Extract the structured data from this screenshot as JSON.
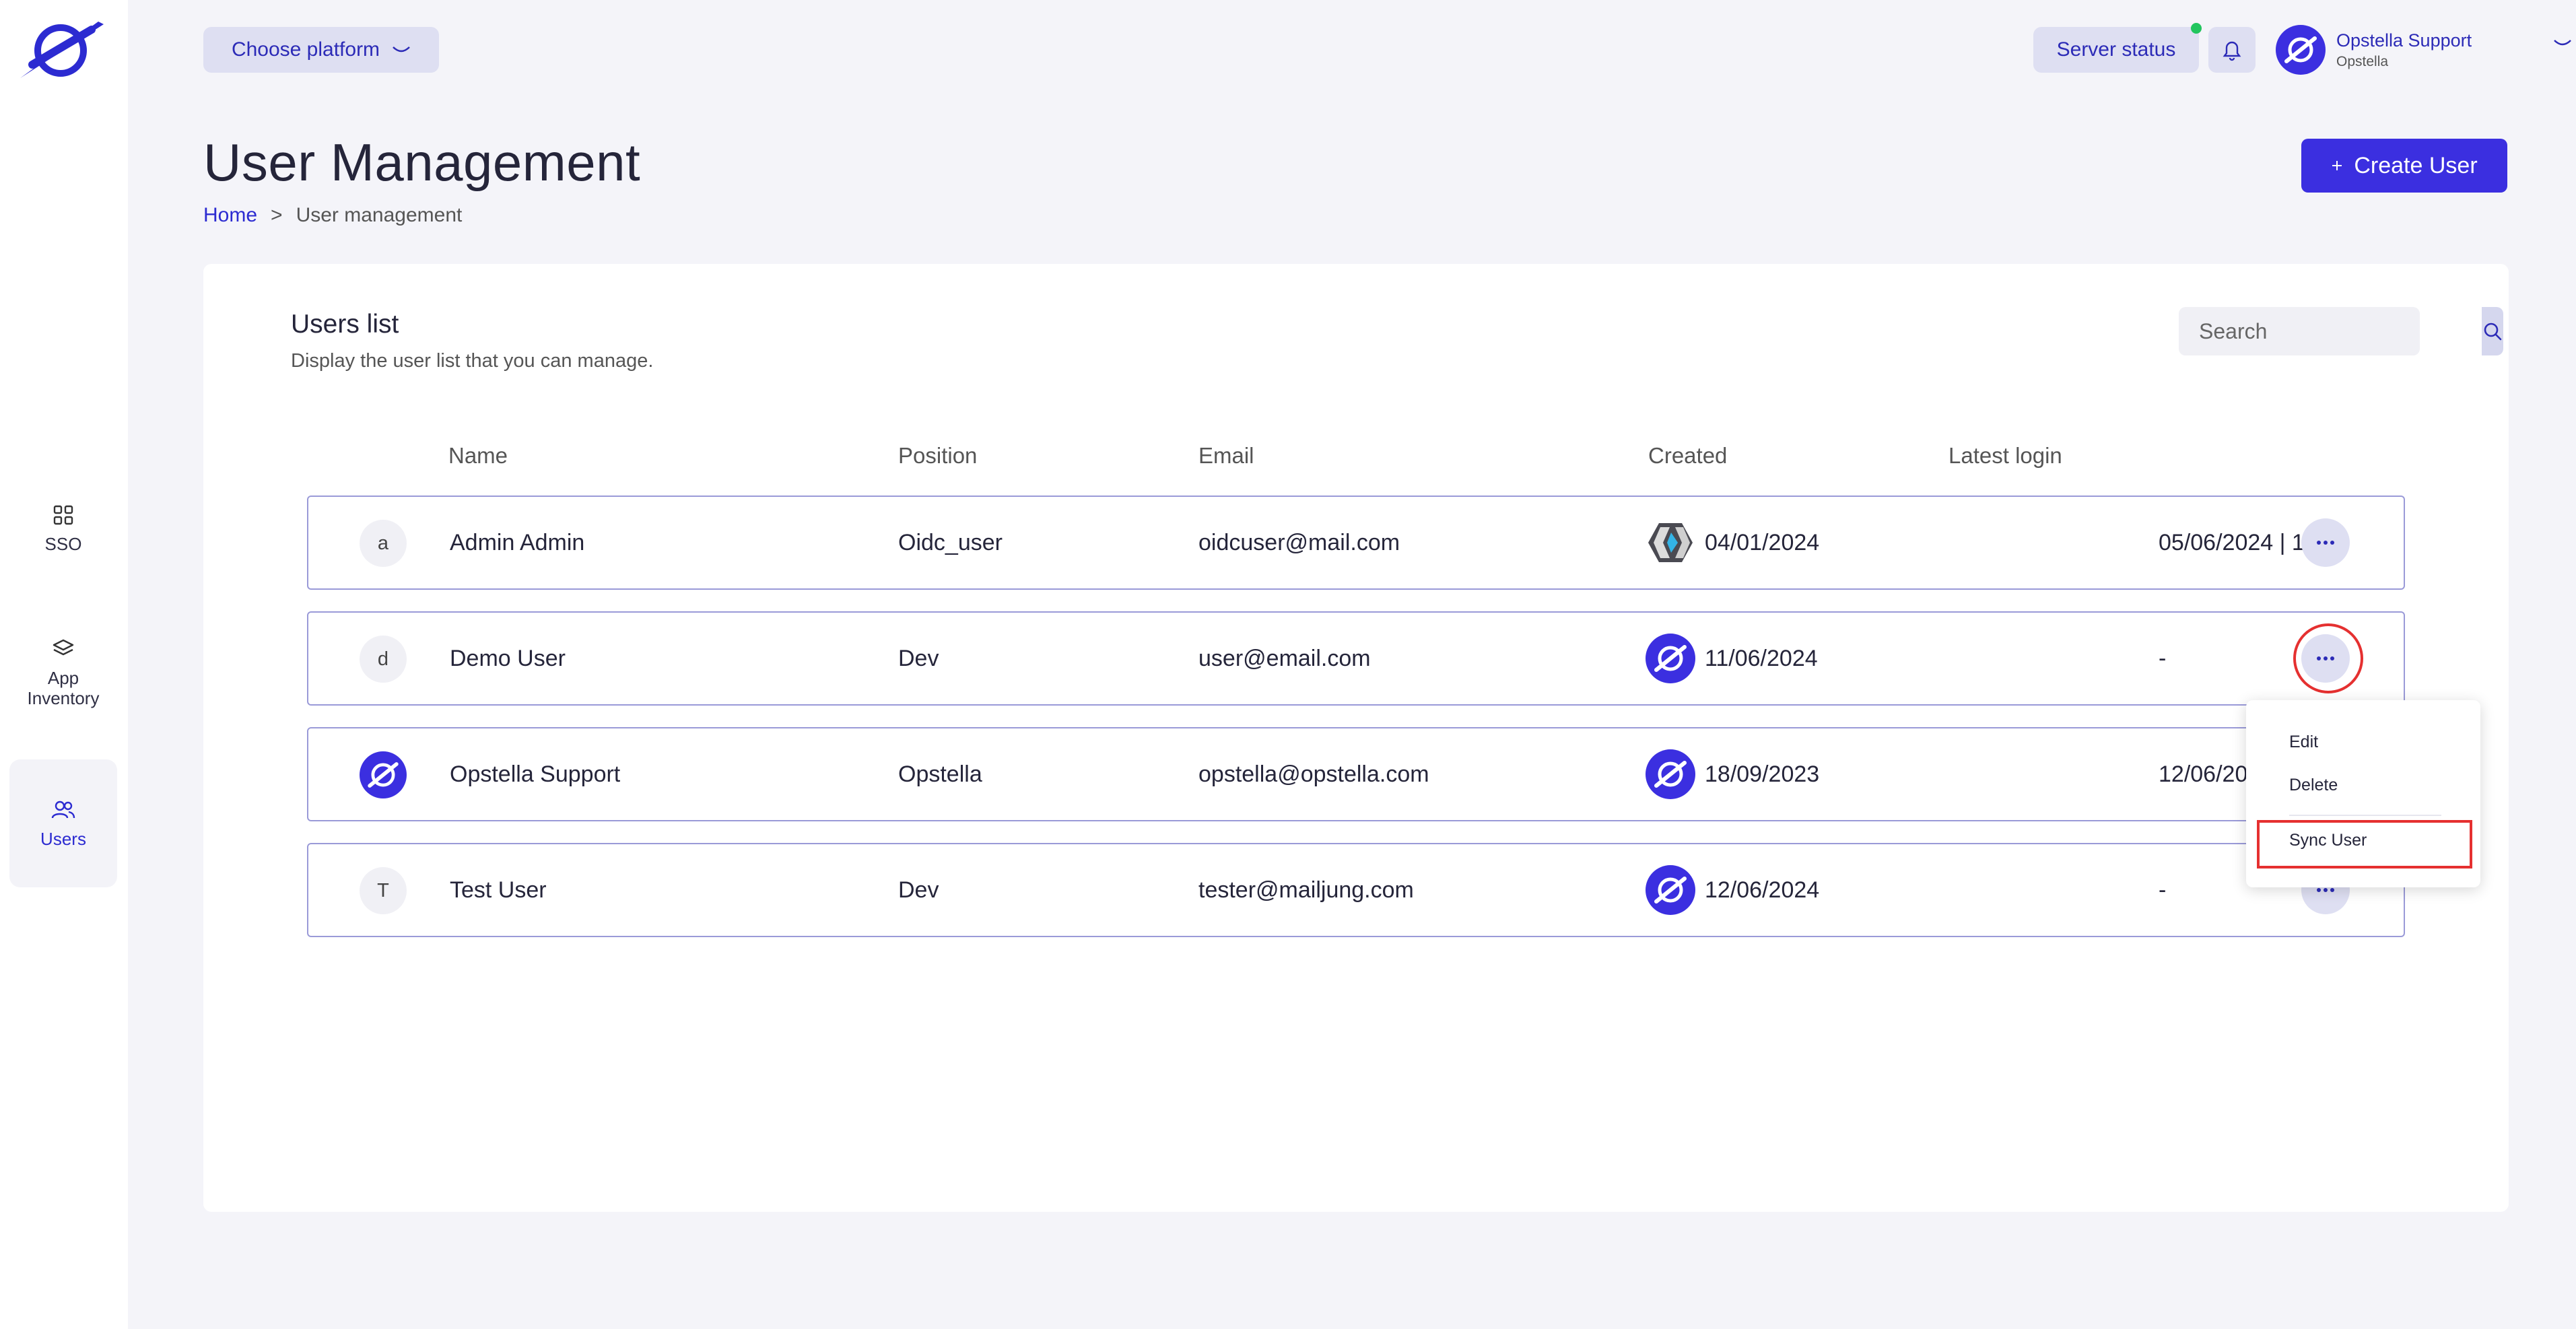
{
  "sidebar": {
    "items": [
      {
        "label": "SSO",
        "icon": "grid-icon"
      },
      {
        "label": "App Inventory",
        "icon": "layers-icon"
      },
      {
        "label": "Users",
        "icon": "users-icon",
        "active": true
      }
    ]
  },
  "header": {
    "platform_label": "Choose platform",
    "server_status_label": "Server status",
    "profile_name": "Opstella Support",
    "profile_org": "Opstella"
  },
  "page": {
    "title": "User Management",
    "breadcrumb_home": "Home",
    "breadcrumb_sep": ">",
    "breadcrumb_current": "User management",
    "create_button": "Create User"
  },
  "users_card": {
    "title": "Users list",
    "subtitle": "Display the user list that you can manage.",
    "search_placeholder": "Search",
    "columns": [
      "Name",
      "Position",
      "Email",
      "Created",
      "Latest login"
    ],
    "rows": [
      {
        "initial": "a",
        "name": "Admin Admin",
        "position": "Oidc_user",
        "email": "oidcuser@mail.com",
        "created": "04/01/2024",
        "latest_login": "05/06/2024 | 17:34",
        "source_icon": "keycloak-icon"
      },
      {
        "initial": "d",
        "name": "Demo User",
        "position": "Dev",
        "email": "user@email.com",
        "created": "11/06/2024",
        "latest_login": "-",
        "source_icon": "opstella-icon"
      },
      {
        "initial": "",
        "name": "Opstella Support",
        "position": "Opstella",
        "email": "opstella@opstella.com",
        "created": "18/09/2023",
        "latest_login": "12/06/2024 | 15:",
        "source_icon": "opstella-icon"
      },
      {
        "initial": "T",
        "name": "Test User",
        "position": "Dev",
        "email": "tester@mailjung.com",
        "created": "12/06/2024",
        "latest_login": "-",
        "source_icon": "opstella-icon"
      }
    ]
  },
  "context_menu": {
    "items": [
      "Edit",
      "Delete",
      "Sync User"
    ]
  },
  "colors": {
    "accent": "#3b2fe0",
    "highlight": "#e53030",
    "status_online": "#22c55e"
  }
}
